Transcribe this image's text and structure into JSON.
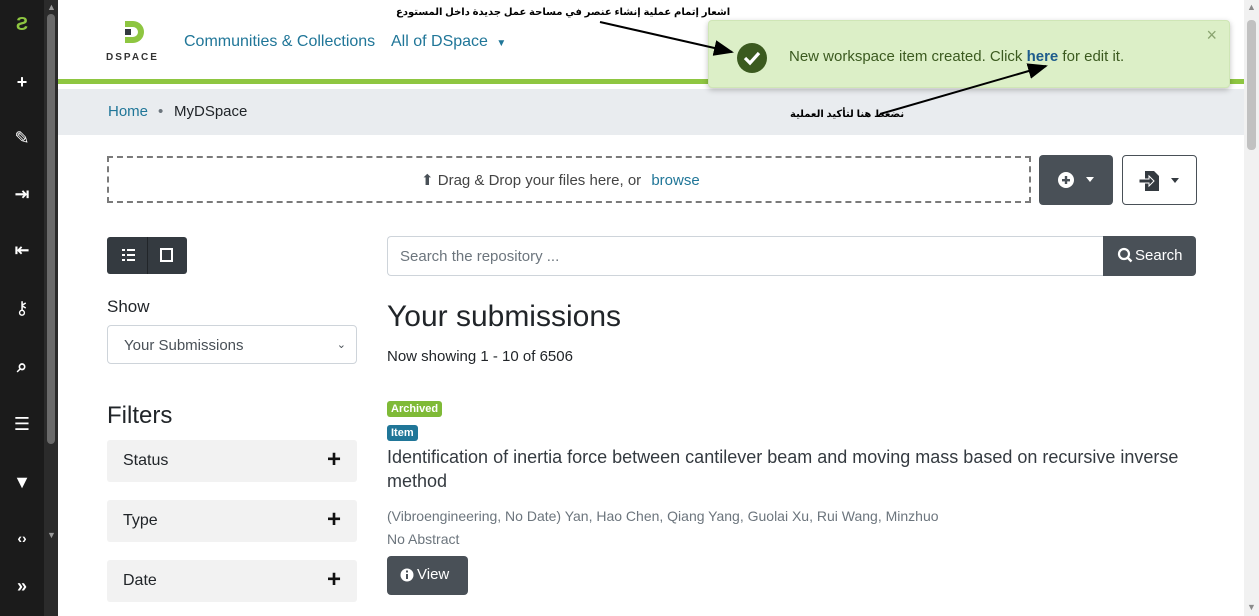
{
  "sidebar": {
    "icons": [
      "dspace-logo-icon",
      "plus-icon",
      "pencil-icon",
      "import-icon",
      "export-icon",
      "key-icon",
      "search-icon",
      "list-icon",
      "filter-icon",
      "code-icon",
      "double-chevron-right-icon"
    ]
  },
  "header": {
    "logo_text": "DSPACE",
    "nav_communities": "Communities & Collections",
    "nav_all": "All of DSpace"
  },
  "breadcrumb": {
    "home": "Home",
    "separator": "•",
    "current": "MyDSpace"
  },
  "toast": {
    "message_before": "New workspace item created. Click ",
    "link": "here",
    "message_after": " for edit it.",
    "close": "×"
  },
  "annotations": {
    "top": "اشعار إتمام عملية إنشاء عنصر في مساحة عمل جديدة داخل المستودع",
    "middle": "نضغط هنا لتأكيد العملية"
  },
  "upload": {
    "text": "Drag & Drop your files here, or",
    "browse": "browse"
  },
  "show": {
    "label": "Show",
    "selected": "Your Submissions"
  },
  "filters": {
    "title": "Filters",
    "items": [
      "Status",
      "Type",
      "Date"
    ]
  },
  "search": {
    "placeholder": "Search the repository ...",
    "button": "Search"
  },
  "results": {
    "title": "Your submissions",
    "showing": "Now showing 1 - 10 of 6506",
    "item": {
      "badge_status": "Archived",
      "badge_type": "Item",
      "title": "Identification of inertia force between cantilever beam and moving mass based on recursive inverse method",
      "meta": "(Vibroengineering, No Date) Yan, Hao Chen, Qiang Yang, Guolai Xu, Rui Wang, Minzhuo",
      "abstract": "No Abstract",
      "view": "View"
    }
  },
  "colors": {
    "accent_green": "#8ec641",
    "link_blue": "#207698",
    "dark": "#495057"
  }
}
